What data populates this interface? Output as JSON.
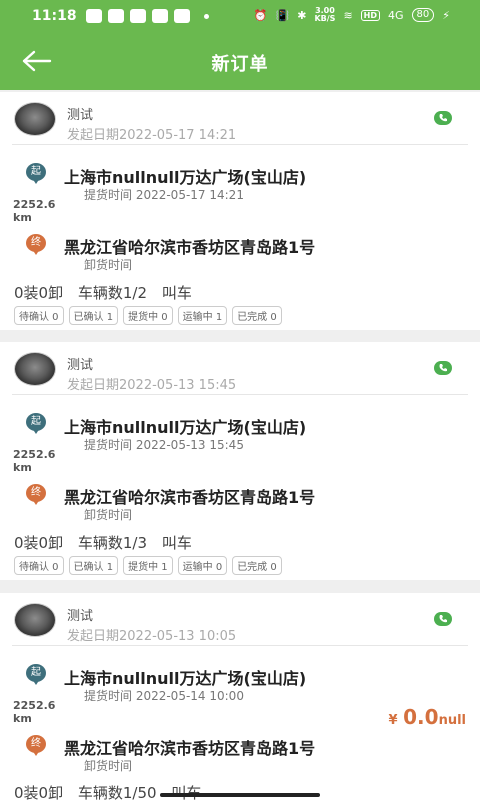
{
  "status_bar": {
    "time": "11:18",
    "net_speed_value": "3.00",
    "net_speed_unit": "KB/S",
    "hd_label": "HD",
    "signal_label": "4G",
    "battery": "80"
  },
  "header": {
    "title": "新订单"
  },
  "orders": [
    {
      "name": "测试",
      "date_label": "发起日期2022-05-17 14:21",
      "from_badge": "起",
      "from_address": "上海市nullnull万达广场(宝山店)",
      "pickup_label": "提货时间 2022-05-17 14:21",
      "distance_value": "2252.6",
      "distance_unit": "km",
      "to_badge": "终",
      "to_address": "黑龙江省哈尔滨市香坊区青岛路1号",
      "unload_label": "卸货时间",
      "load_info": "0装0卸",
      "vehicle_info": "车辆数1/2",
      "call_car": "叫车",
      "statuses": [
        "待确认 0",
        "已确认 1",
        "提货中 0",
        "运输中 1",
        "已完成 0"
      ]
    },
    {
      "name": "测试",
      "date_label": "发起日期2022-05-13 15:45",
      "from_badge": "起",
      "from_address": "上海市nullnull万达广场(宝山店)",
      "pickup_label": "提货时间 2022-05-13 15:45",
      "distance_value": "2252.6",
      "distance_unit": "km",
      "to_badge": "终",
      "to_address": "黑龙江省哈尔滨市香坊区青岛路1号",
      "unload_label": "卸货时间",
      "load_info": "0装0卸",
      "vehicle_info": "车辆数1/3",
      "call_car": "叫车",
      "statuses": [
        "待确认 0",
        "已确认 1",
        "提货中 1",
        "运输中 0",
        "已完成 0"
      ]
    },
    {
      "name": "测试",
      "date_label": "发起日期2022-05-13 10:05",
      "from_badge": "起",
      "from_address": "上海市nullnull万达广场(宝山店)",
      "pickup_label": "提货时间 2022-05-14 10:00",
      "distance_value": "2252.6",
      "distance_unit": "km",
      "to_badge": "终",
      "to_address": "黑龙江省哈尔滨市香坊区青岛路1号",
      "unload_label": "卸货时间",
      "load_info": "0装0卸",
      "vehicle_info": "车辆数1/50",
      "call_car": "叫车",
      "price_symbol": "¥",
      "price_value": "0.0",
      "price_unit": "null"
    }
  ],
  "colors": {
    "accent": "#6ab94f",
    "start_pin": "#3e6f7c",
    "end_pin": "#d4703e",
    "price": "#d4703e"
  }
}
